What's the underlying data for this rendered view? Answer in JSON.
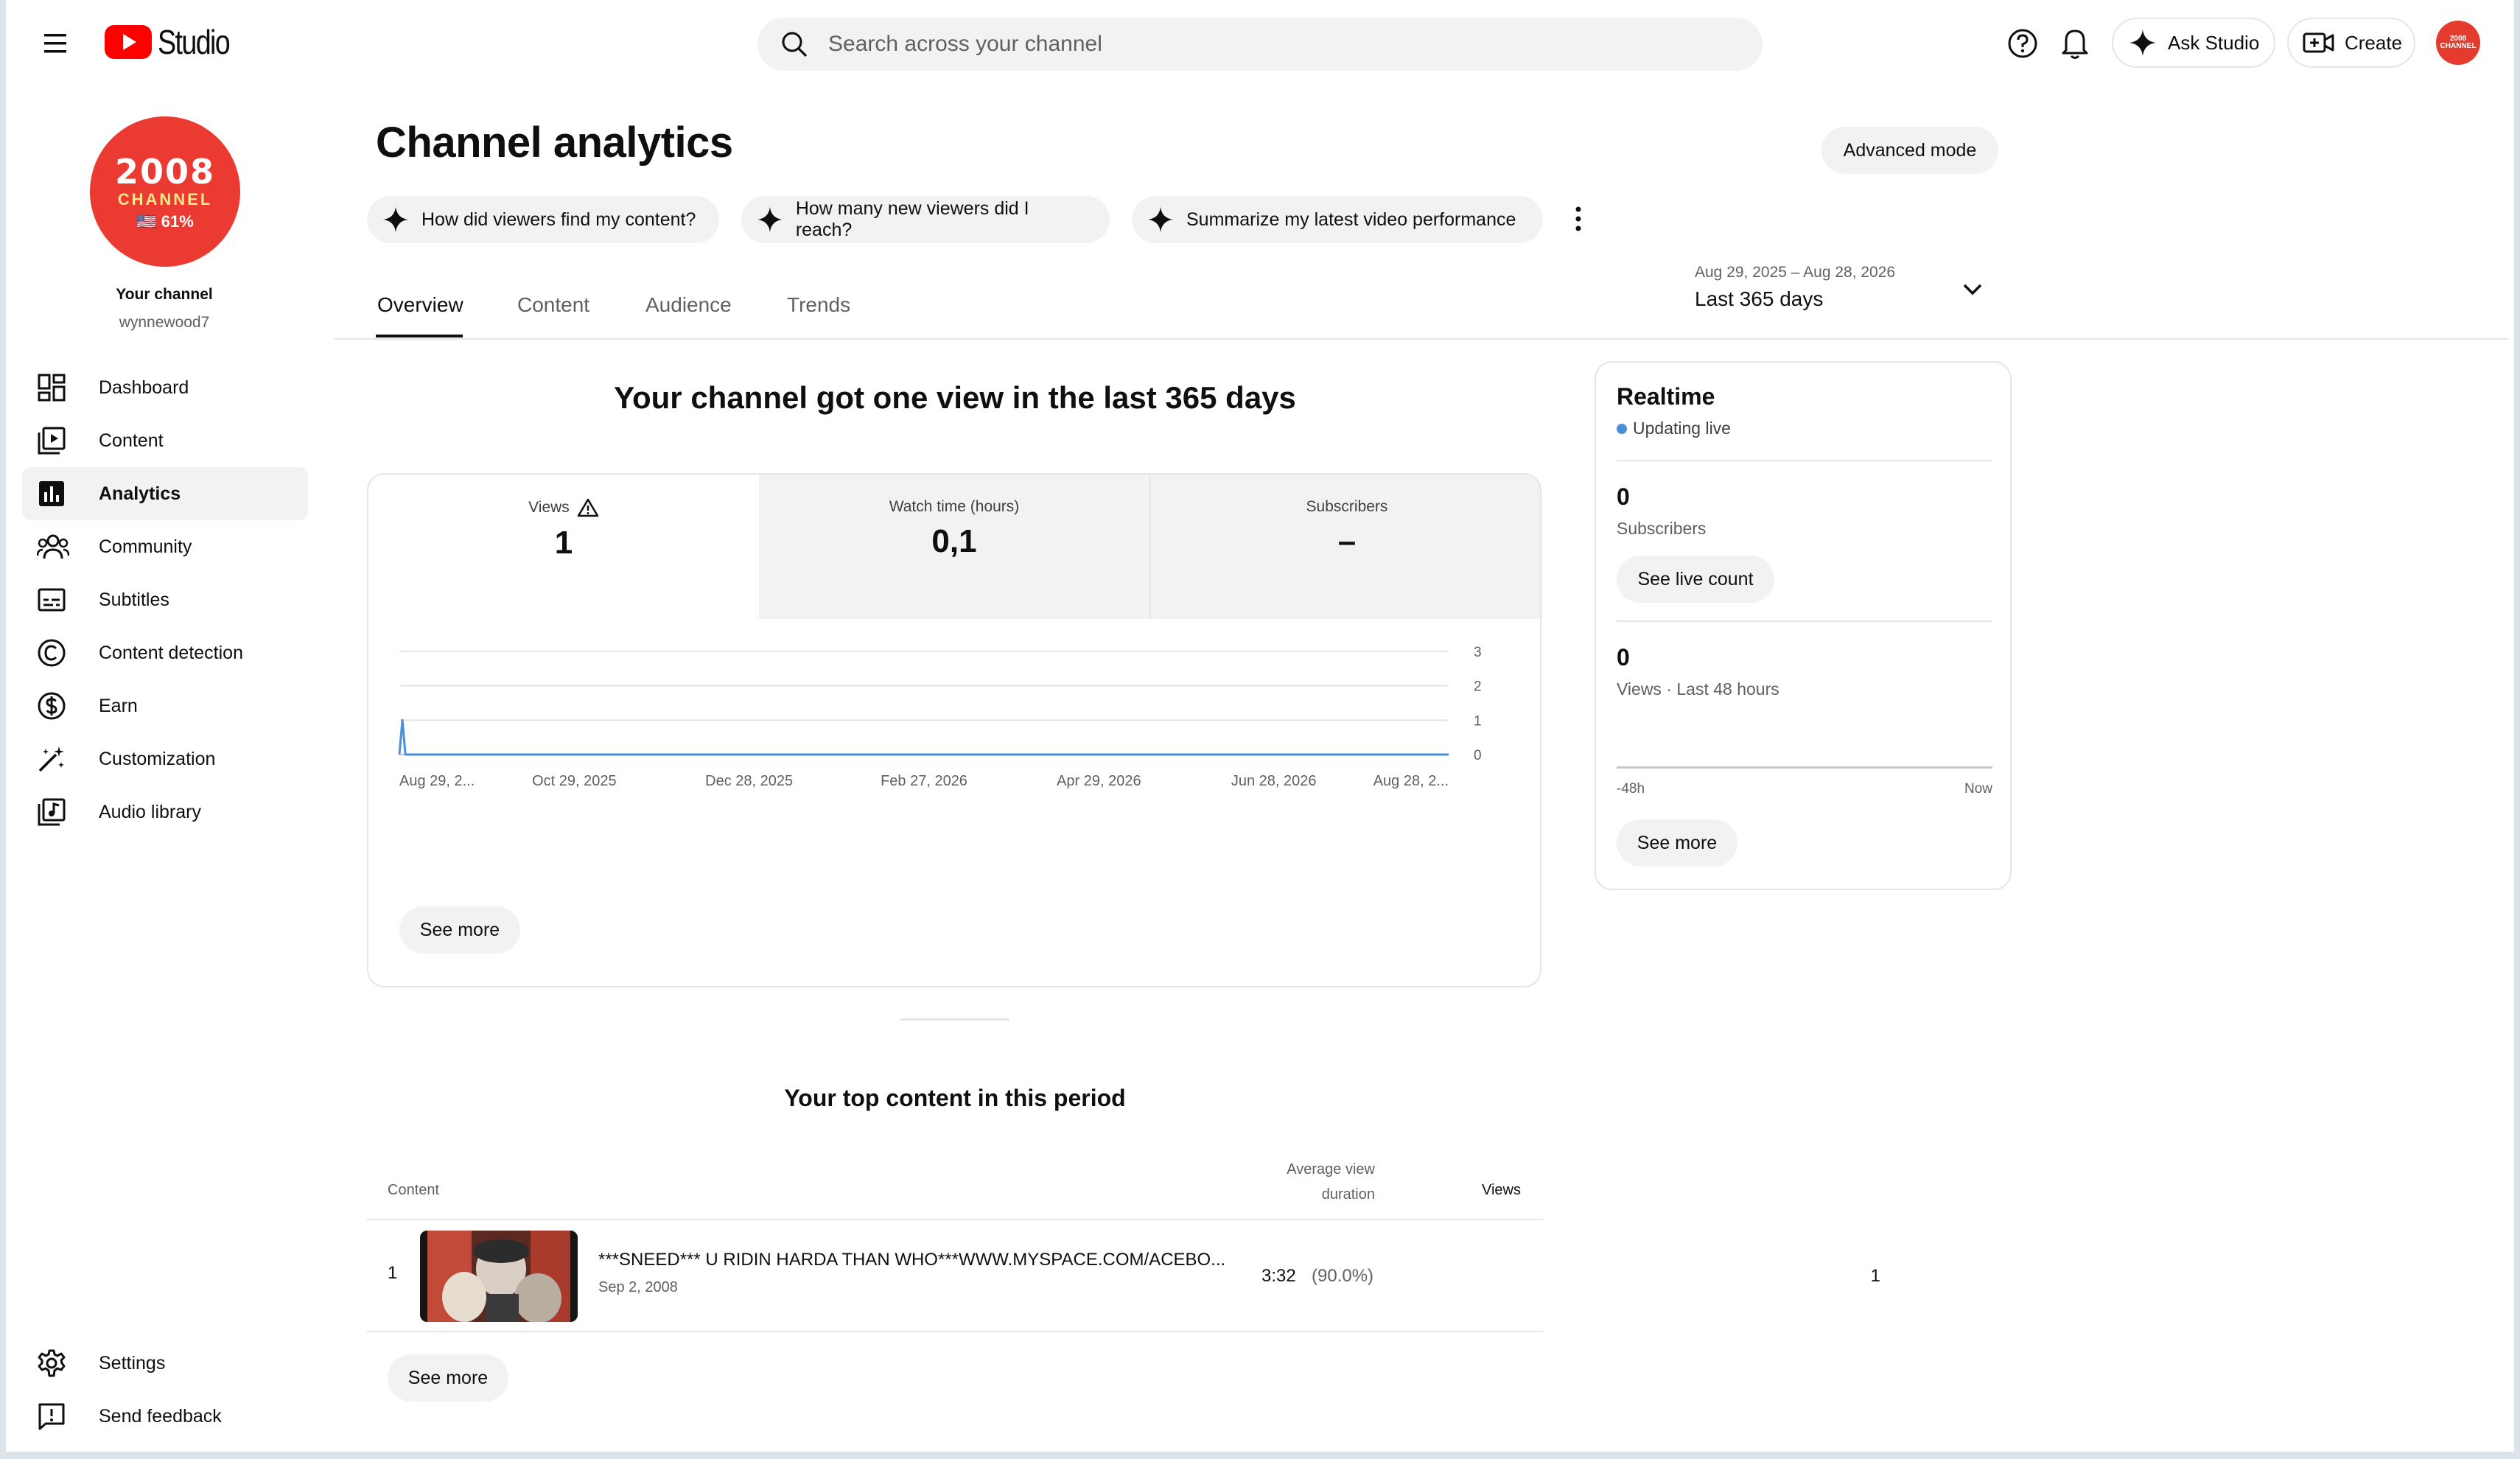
{
  "header": {
    "logo_text": "Studio",
    "search_placeholder": "Search across your channel",
    "ask_studio": "Ask Studio",
    "create": "Create",
    "avatar_text": "2008 CHANNEL"
  },
  "sidebar": {
    "avatar": {
      "line1": "2008",
      "line2": "CHANNEL",
      "line3": "🇺🇸 61%"
    },
    "channel_label": "Your channel",
    "handle": "wynnewood7",
    "items": [
      {
        "label": "Dashboard",
        "icon": "dashboard-icon"
      },
      {
        "label": "Content",
        "icon": "content-icon"
      },
      {
        "label": "Analytics",
        "icon": "analytics-icon",
        "active": true
      },
      {
        "label": "Community",
        "icon": "community-icon"
      },
      {
        "label": "Subtitles",
        "icon": "subtitles-icon"
      },
      {
        "label": "Content detection",
        "icon": "copyright-icon"
      },
      {
        "label": "Earn",
        "icon": "dollar-icon"
      },
      {
        "label": "Customization",
        "icon": "magic-wand-icon"
      },
      {
        "label": "Audio library",
        "icon": "audio-library-icon"
      }
    ],
    "bottom": [
      {
        "label": "Settings",
        "icon": "gear-icon"
      },
      {
        "label": "Send feedback",
        "icon": "feedback-icon"
      }
    ]
  },
  "main": {
    "title": "Channel analytics",
    "advanced_mode": "Advanced mode",
    "chips": [
      "How did viewers find my content?",
      "How many new viewers did I reach?",
      "Summarize my latest video performance"
    ],
    "date_range": "Aug 29, 2025 – Aug 28, 2026",
    "date_label": "Last 365 days",
    "tabs": [
      "Overview",
      "Content",
      "Audience",
      "Trends"
    ],
    "headline": "Your channel got one view in the last 365 days",
    "metrics": [
      {
        "label": "Views",
        "value": "1"
      },
      {
        "label": "Watch time (hours)",
        "value": "0,1"
      },
      {
        "label": "Subscribers",
        "value": "–"
      }
    ],
    "see_more": "See more",
    "top_content": {
      "title": "Your top content in this period",
      "col_content": "Content",
      "col_avg_line1": "Average view",
      "col_avg_line2": "duration",
      "col_views": "Views",
      "rows": [
        {
          "rank": "1",
          "title": "***SNEED*** U RIDIN HARDA THAN WHO***WWW.MYSPACE.COM/ACEBO...",
          "date": "Sep 2, 2008",
          "duration": "3:32",
          "percent": "(90.0%)",
          "views": "1"
        }
      ],
      "see_more": "See more"
    }
  },
  "realtime": {
    "title": "Realtime",
    "status": "Updating live",
    "subscribers_value": "0",
    "subscribers_label": "Subscribers",
    "see_live_count": "See live count",
    "views_value": "0",
    "views_label": "Views · Last 48 hours",
    "axis_left": "-48h",
    "axis_right": "Now",
    "see_more": "See more"
  },
  "chart_data": {
    "type": "line",
    "series": [
      {
        "values": [
          0,
          1,
          0,
          0,
          0,
          0,
          0,
          0,
          0,
          0,
          0,
          0,
          0,
          0,
          0,
          0,
          0,
          0,
          0,
          0,
          0,
          0,
          0,
          0,
          0,
          0,
          0,
          0,
          0,
          0,
          0,
          0,
          0,
          0,
          0,
          0,
          0,
          0,
          0,
          0,
          0,
          0,
          0,
          0,
          0,
          0,
          0,
          0,
          0,
          0,
          0,
          0,
          0,
          0,
          0,
          0,
          0,
          0,
          0,
          0,
          0,
          0,
          0,
          0,
          0,
          0,
          0,
          0,
          0,
          0,
          0,
          0,
          0,
          0,
          0,
          0,
          0,
          0,
          0,
          0,
          0,
          0,
          0,
          0,
          0,
          0,
          0,
          0,
          0,
          0,
          0,
          0,
          0,
          0,
          0,
          0,
          0,
          0,
          0,
          0,
          0,
          0,
          0,
          0,
          0,
          0,
          0,
          0,
          0,
          0,
          0,
          0,
          0,
          0,
          0,
          0,
          0,
          0,
          0,
          0,
          0,
          0,
          0,
          0,
          0,
          0,
          0,
          0,
          0,
          0,
          0,
          0,
          0,
          0,
          0,
          0,
          0,
          0,
          0,
          0,
          0,
          0,
          0,
          0,
          0,
          0,
          0,
          0,
          0,
          0,
          0,
          0,
          0,
          0,
          0,
          0,
          0,
          0,
          0,
          0,
          0,
          0,
          0,
          0,
          0,
          0,
          0,
          0,
          0,
          0,
          0,
          0,
          0,
          0,
          0,
          0,
          0,
          0,
          0,
          0,
          0,
          0,
          0,
          0,
          0,
          0,
          0,
          0,
          0,
          0,
          0,
          0,
          0,
          0,
          0,
          0,
          0,
          0,
          0,
          0,
          0,
          0,
          0,
          0,
          0,
          0,
          0,
          0,
          0,
          0,
          0,
          0,
          0,
          0,
          0,
          0,
          0,
          0,
          0,
          0,
          0,
          0,
          0,
          0,
          0,
          0,
          0,
          0,
          0,
          0,
          0,
          0,
          0,
          0,
          0,
          0,
          0,
          0,
          0,
          0,
          0,
          0,
          0,
          0,
          0,
          0,
          0,
          0,
          0,
          0,
          0,
          0,
          0,
          0,
          0,
          0,
          0,
          0,
          0,
          0,
          0,
          0,
          0,
          0,
          0,
          0,
          0,
          0,
          0,
          0,
          0,
          0,
          0,
          0,
          0,
          0,
          0,
          0,
          0,
          0,
          0,
          0,
          0,
          0,
          0,
          0,
          0,
          0,
          0,
          0,
          0,
          0,
          0,
          0,
          0,
          0,
          0,
          0,
          0,
          0,
          0,
          0,
          0,
          0,
          0,
          0,
          0,
          0,
          0,
          0,
          0,
          0,
          0,
          0,
          0,
          0,
          0,
          0,
          0,
          0,
          0,
          0,
          0,
          0,
          0,
          0,
          0,
          0,
          0,
          0,
          0,
          0,
          0,
          0,
          0,
          0,
          0,
          0,
          0,
          0,
          0,
          0,
          0,
          0,
          0,
          0,
          0,
          0,
          0,
          0
        ]
      }
    ],
    "x_tick_labels": [
      "Aug 29, 2...",
      "Oct 29, 2025",
      "Dec 28, 2025",
      "Feb 27, 2026",
      "Apr 29, 2026",
      "Jun 28, 2026",
      "Aug 28, 2..."
    ],
    "y_ticks": [
      "3",
      "2",
      "1",
      "0"
    ],
    "ylim": [
      0,
      3
    ],
    "grid": true,
    "color": "#4a90d9"
  }
}
